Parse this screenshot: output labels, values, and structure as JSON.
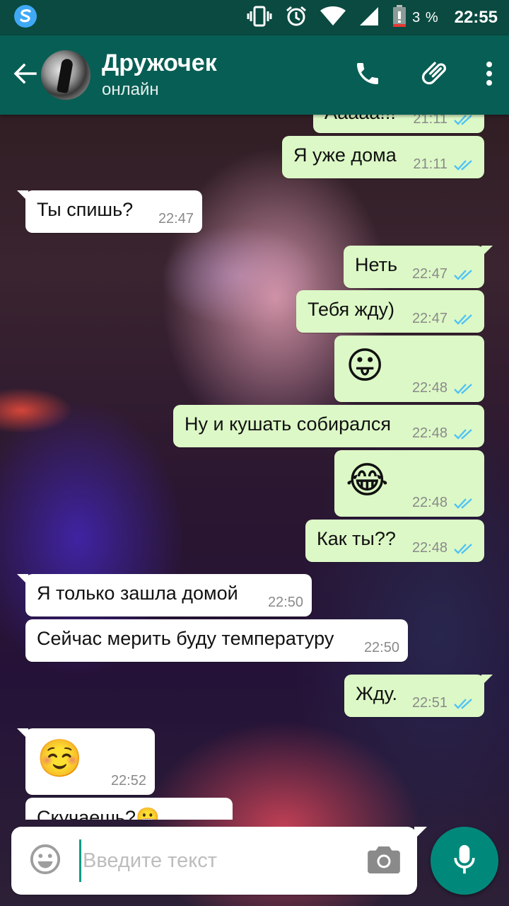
{
  "status_bar": {
    "battery_percent": "3 %",
    "time": "22:55"
  },
  "header": {
    "contact_name": "Дружочек",
    "contact_status": "онлайн"
  },
  "messages": [
    {
      "dir": "out",
      "text": "Ааааа!!!",
      "time": "21:11",
      "read": true
    },
    {
      "dir": "out",
      "text": "Я уже дома",
      "time": "21:11",
      "read": true
    },
    {
      "dir": "in",
      "text": "Ты спишь?",
      "time": "22:47"
    },
    {
      "dir": "out",
      "text": "Неть",
      "time": "22:47",
      "read": true
    },
    {
      "dir": "out",
      "text": "Тебя жду)",
      "time": "22:47",
      "read": true
    },
    {
      "dir": "out",
      "text": "😛",
      "time": "22:48",
      "read": true
    },
    {
      "dir": "out",
      "text": "Ну и кушать собирался",
      "time": "22:48",
      "read": true
    },
    {
      "dir": "out",
      "text": "😂",
      "time": "22:48",
      "read": true
    },
    {
      "dir": "out",
      "text": "Как ты??",
      "time": "22:48",
      "read": true
    },
    {
      "dir": "in",
      "text": "Я только зашла домой",
      "time": "22:50"
    },
    {
      "dir": "in",
      "text": "Сейчас мерить буду температуру",
      "time": "22:50"
    },
    {
      "dir": "out",
      "text": "Жду.",
      "time": "22:51",
      "read": true
    },
    {
      "dir": "in",
      "text": "☺️",
      "time": "22:52"
    },
    {
      "dir": "in",
      "text": "Скучаешь?😬",
      "time": ""
    }
  ],
  "input": {
    "placeholder": "Введите текст",
    "value": ""
  },
  "colors": {
    "header": "#075e54",
    "status_bar": "#0a4a40",
    "outgoing_bubble": "#dcf8c6",
    "incoming_bubble": "#ffffff",
    "read_ticks": "#4fc3f7",
    "fab": "#00897b"
  },
  "icons": [
    "app-notification-icon",
    "vibrate-icon",
    "alarm-icon",
    "wifi-icon",
    "signal-icon",
    "battery-icon",
    "back-arrow-icon",
    "phone-icon",
    "paperclip-icon",
    "more-vert-icon",
    "emoji-icon",
    "camera-icon",
    "mic-icon"
  ]
}
